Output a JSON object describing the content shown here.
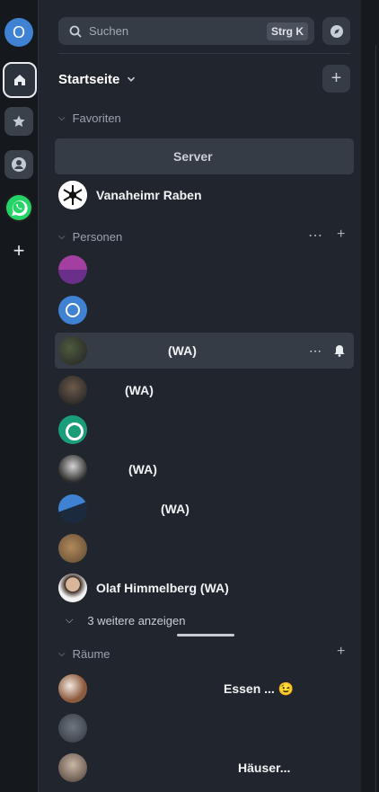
{
  "rail": {
    "account_initial": "O",
    "add_label": "+"
  },
  "search": {
    "placeholder": "Suchen",
    "shortcut": "Strg K"
  },
  "home": {
    "title": "Startseite",
    "add_label": "+"
  },
  "sections": {
    "favorites": "Favoriten",
    "people": "Personen",
    "rooms": "Räume"
  },
  "favorites": [
    {
      "name": "Server"
    },
    {
      "name": "Vanaheimr Raben"
    }
  ],
  "people": [
    {
      "name": ""
    },
    {
      "name": ""
    },
    {
      "name": "(WA)"
    },
    {
      "name": "(WA)"
    },
    {
      "name": ""
    },
    {
      "name": "(WA)"
    },
    {
      "name": "(WA)"
    },
    {
      "name": ""
    },
    {
      "name": "Olaf Himmelberg (WA)"
    }
  ],
  "show_more": "3 weitere anzeigen",
  "rooms": [
    {
      "name": "Essen ... 😉"
    },
    {
      "name": ""
    },
    {
      "name": "Häuser..."
    }
  ],
  "colors": {
    "accent": "#3f82d4",
    "whatsapp": "#25d366",
    "panel_bg": "#21262e",
    "rail_bg": "#15191e"
  }
}
